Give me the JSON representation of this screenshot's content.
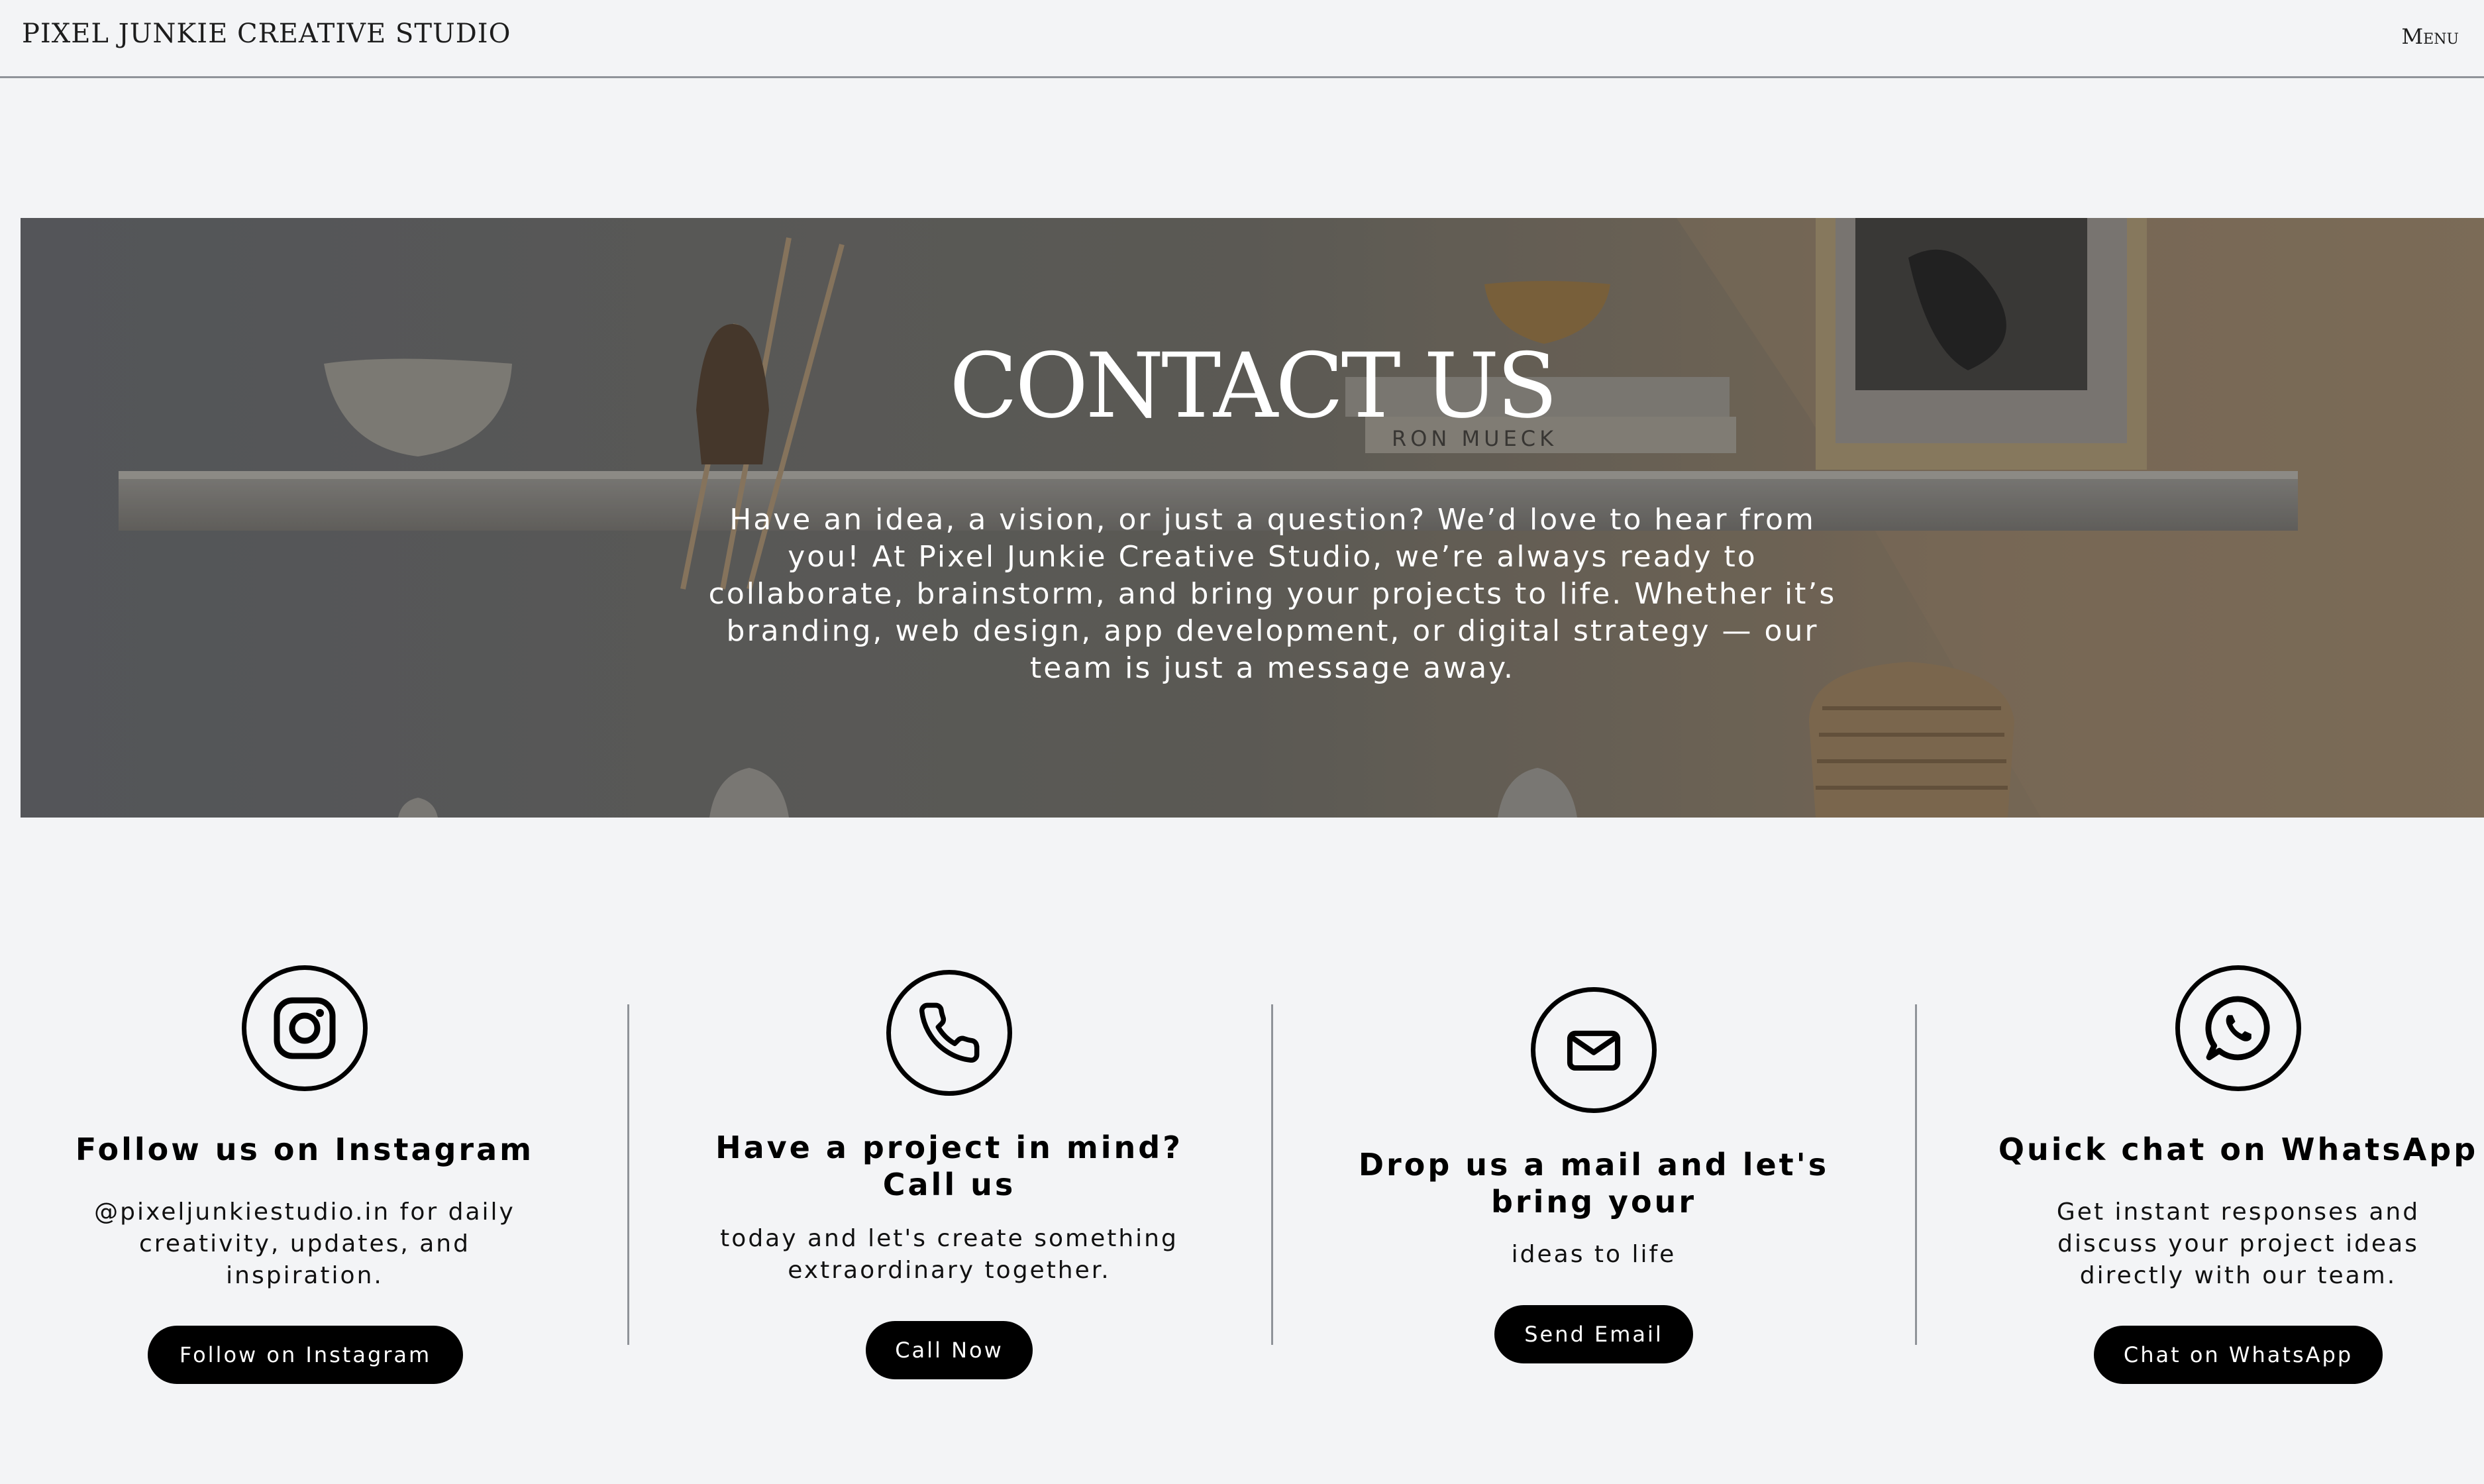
{
  "header": {
    "brand": "PIXEL JUNKIE CREATIVE STUDIO",
    "menu_label": "Menu"
  },
  "hero": {
    "title": "CONTACT US",
    "text": "Have an idea, a vision, or just a question? We’d love to hear from you! At Pixel Junkie Creative Studio, we’re always ready to collaborate, brainstorm, and bring your projects to life. Whether it’s branding, web design, app development, or digital strategy — our team is just a message away.",
    "book_label": "RON MUECK"
  },
  "contacts": [
    {
      "icon": "instagram-icon",
      "title": "Follow us on Instagram",
      "text": "@pixeljunkiestudio.in for daily creativity, updates, and inspiration.",
      "button": "Follow on Instagram"
    },
    {
      "icon": "phone-icon",
      "title": "Have a project in mind? Call us",
      "text": "today and let's create something extraordinary together.",
      "button": "Call Now"
    },
    {
      "icon": "mail-icon",
      "title": "Drop us a mail and let's bring your",
      "text": "ideas to life",
      "button": "Send Email"
    },
    {
      "icon": "whatsapp-icon",
      "title": "Quick chat on WhatsApp",
      "text": "Get instant responses and discuss your project ideas directly with our team.",
      "button": "Chat on WhatsApp"
    }
  ],
  "colors": {
    "background": "#f3f4f6",
    "button": "#000000",
    "button_text": "#ffffff"
  }
}
